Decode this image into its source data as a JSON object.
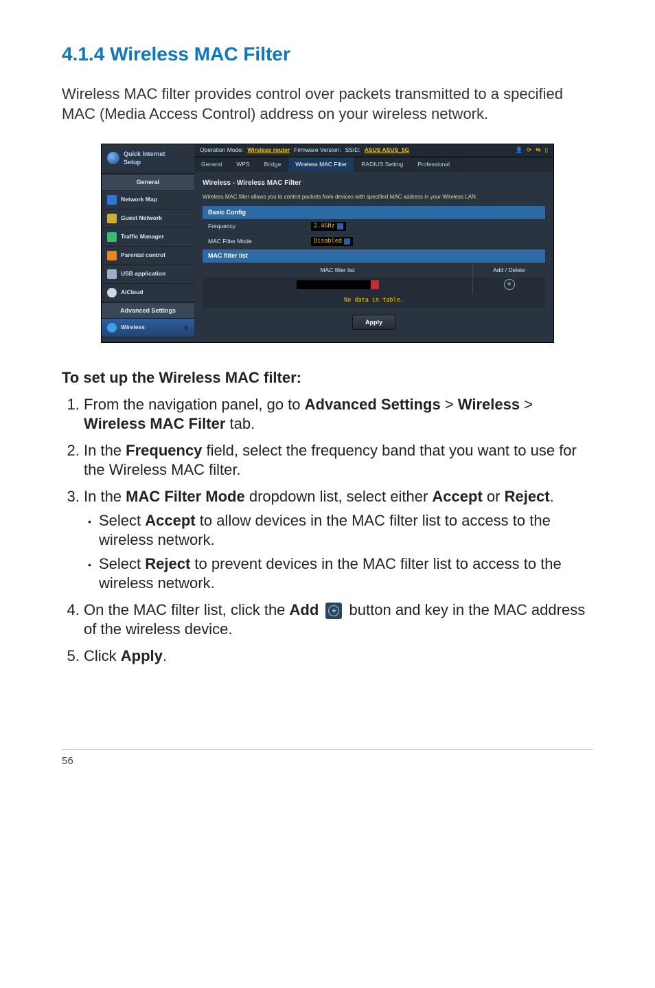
{
  "doc": {
    "section_number": "4.1.4",
    "section_title": "Wireless MAC Filter",
    "intro": "Wireless MAC filter provides control over packets transmitted to a specified MAC (Media Access Control) address on your wireless network.",
    "subhead": "To set up the Wireless MAC filter:",
    "steps": {
      "s1_a": "From the navigation panel, go to ",
      "s1_b": "Advanced Settings",
      "s1_c": " > ",
      "s1_d": "Wireless",
      "s1_e": " > ",
      "s1_f": "Wireless MAC Filter",
      "s1_g": " tab.",
      "s2_a": "In the ",
      "s2_b": "Frequency",
      "s2_c": " field, select the frequency band that you want to use for the Wireless MAC filter.",
      "s3_a": "In the ",
      "s3_b": "MAC Filter Mode",
      "s3_c": " dropdown list, select either ",
      "s3_d": "Accept",
      "s3_e": " or ",
      "s3_f": "Reject",
      "s3_g": ".",
      "b1_a": "Select ",
      "b1_b": "Accept",
      "b1_c": " to allow devices in the MAC filter list to access to the wireless network.",
      "b2_a": "Select ",
      "b2_b": "Reject",
      "b2_c": " to prevent devices in the MAC filter list to access to the wireless network.",
      "s4_a": "On the MAC filter list, click the ",
      "s4_b": "Add",
      "s4_c": "  button and key in the MAC address of the wireless device.",
      "s5_a": "Click ",
      "s5_b": "Apply",
      "s5_c": "."
    },
    "page_number": "56"
  },
  "ui": {
    "qis_l1": "Quick Internet",
    "qis_l2": "Setup",
    "section_general": "General",
    "nav": {
      "map": "Network Map",
      "guest": "Guest Network",
      "tm": "Traffic Manager",
      "par": "Parental control",
      "usb": "USB application",
      "cloud": "AiCloud"
    },
    "section_adv": "Advanced Settings",
    "nav_wireless": "Wireless",
    "bar": {
      "opmode_label": "Operation Mode: ",
      "opmode_value": "Wireless router",
      "fw_label": "Firmware Version:",
      "ssid_label": "SSID: ",
      "ssid_value": "ASUS  ASUS_5G"
    },
    "tabs": {
      "general": "General",
      "wps": "WPS",
      "bridge": "Bridge",
      "wmf": "Wireless MAC Filter",
      "radius": "RADIUS Setting",
      "prof": "Professional"
    },
    "panel": {
      "title": "Wireless - Wireless MAC Filter",
      "desc": "Wireless MAC filter allows you to control packets from devices with specified MAC address in your Wireless LAN.",
      "basic_config": "Basic Config",
      "frequency_label": "Frequency",
      "frequency_value": "2.4GHz",
      "mode_label": "MAC Filter Mode",
      "mode_value": "Disabled",
      "list_header": "MAC filter list",
      "col_mac": "MAC filter list",
      "col_add": "Add / Delete",
      "nodata": "No data in table.",
      "apply": "Apply",
      "plus": "+"
    }
  }
}
